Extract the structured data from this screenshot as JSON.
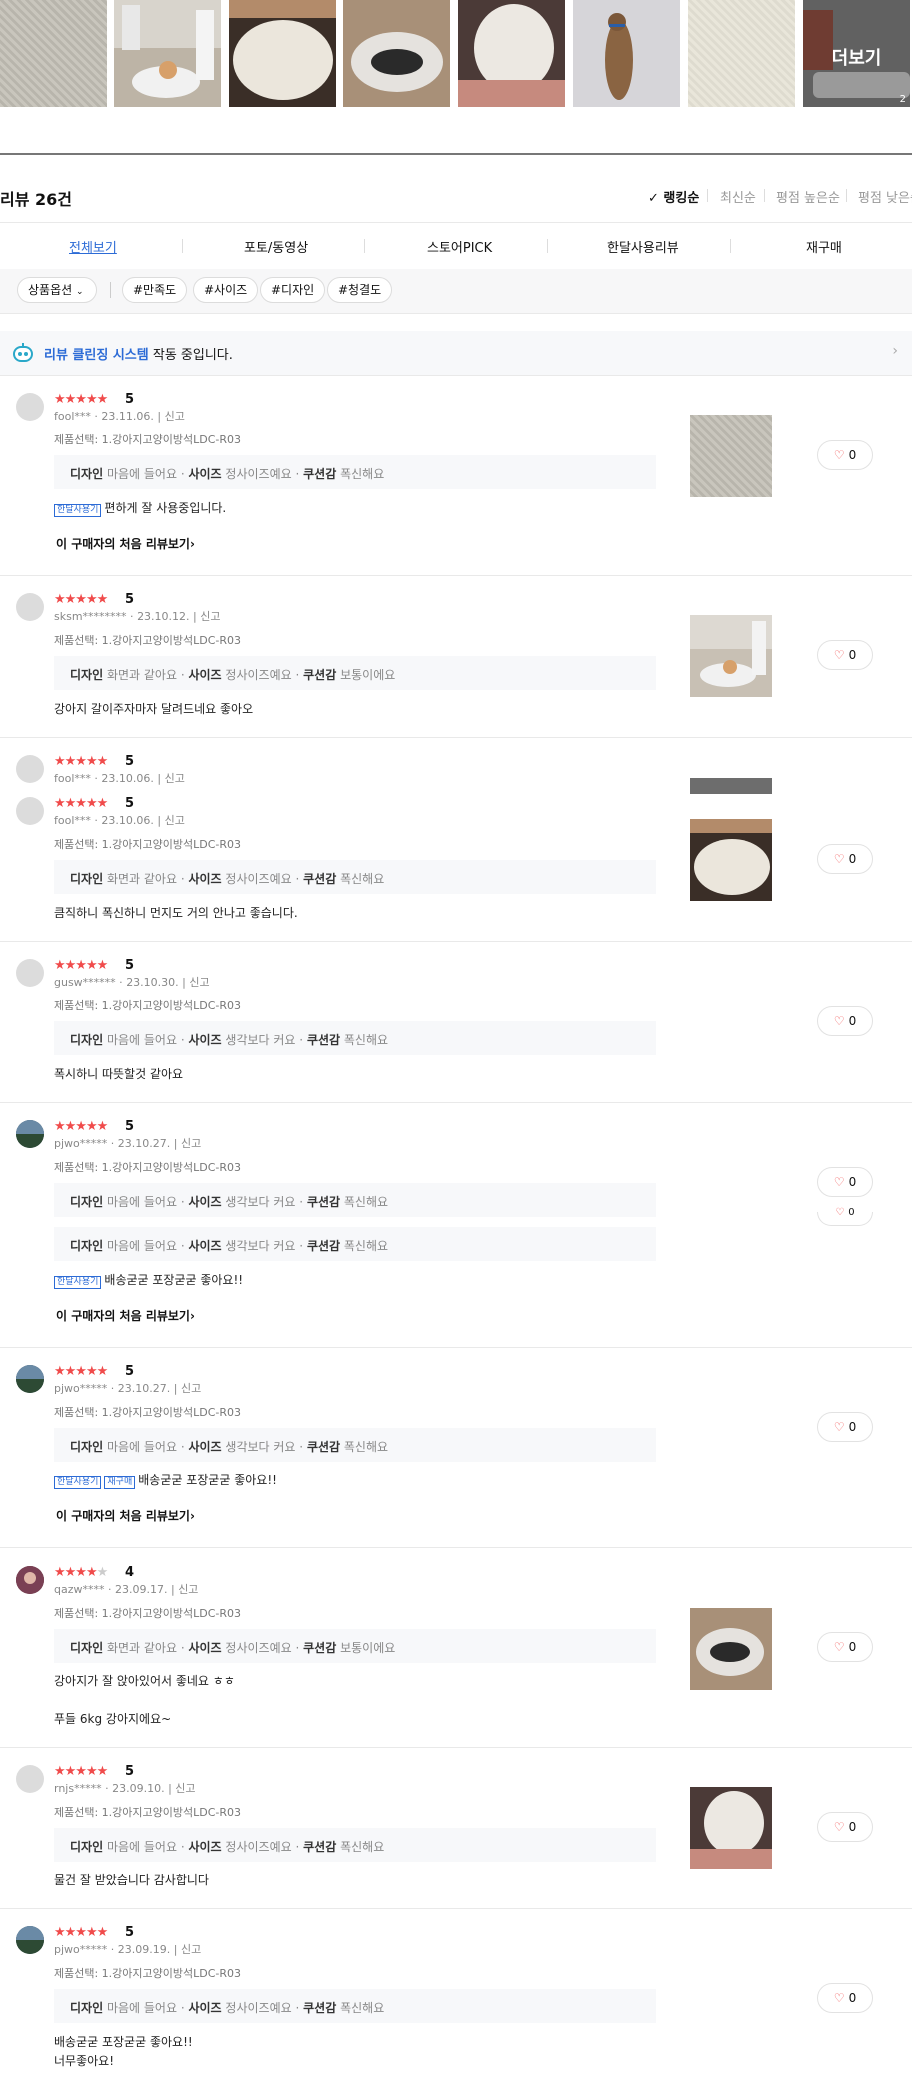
{
  "gallery": {
    "more_label": "더보기",
    "more_count": "2"
  },
  "header": {
    "title": "리뷰 26건",
    "sort": [
      "✓ 랭킹순",
      "최신순",
      "평점 높은순",
      "평점 낮은순"
    ]
  },
  "tabs": [
    "전체보기",
    "포토/동영상",
    "스토어PICK",
    "한달사용리뷰",
    "재구매"
  ],
  "filters": {
    "option": "상품옵션",
    "tags": [
      "#만족도",
      "#사이즈",
      "#디자인",
      "#청결도"
    ]
  },
  "notice": {
    "highlight": "리뷰 클린징 시스템",
    "text": "작동 중입니다."
  },
  "labels": {
    "report": "신고",
    "first_review": "이 구매자의 처음 리뷰보기",
    "badge_month": "한달사용기",
    "badge_rebuy": "재구매"
  },
  "reviews": [
    {
      "stars": 5,
      "score": "5",
      "user": "fool***",
      "date": "23.11.06.",
      "option": "제품선택: 1.강아지고양이방석LDC-R03",
      "attr": [
        [
          "디자인",
          "마음에 들어요"
        ],
        [
          "사이즈",
          "정사이즈예요"
        ],
        [
          "쿠션감",
          "폭신해요"
        ]
      ],
      "text": "편하게 잘 사용중입니다.",
      "likes": "0"
    },
    {
      "stars": 5,
      "score": "5",
      "user": "sksm********",
      "date": "23.10.12.",
      "option": "제품선택: 1.강아지고양이방석LDC-R03",
      "attr": [
        [
          "디자인",
          "화면과 같아요"
        ],
        [
          "사이즈",
          "정사이즈예요"
        ],
        [
          "쿠션감",
          "보통이에요"
        ]
      ],
      "text": "강아지 갈이주자마자 달려드네요 좋아오",
      "likes": "0"
    },
    {
      "stars": 5,
      "score": "5",
      "user": "fool***",
      "date": "23.10.06.",
      "option": "제품선택: 1.강아지고양이방석LDC-R03",
      "attr": [
        [
          "디자인",
          "화면과 같아요"
        ],
        [
          "사이즈",
          "정사이즈예요"
        ],
        [
          "쿠션감",
          "폭신해요"
        ]
      ],
      "text": "큼직하니 폭신하니 먼지도 거의 안나고 좋습니다.",
      "likes": "0"
    },
    {
      "stars": 5,
      "score": "5",
      "user": "gusw******",
      "date": "23.10.30.",
      "option": "제품선택: 1.강아지고양이방석LDC-R03",
      "attr": [
        [
          "디자인",
          "마음에 들어요"
        ],
        [
          "사이즈",
          "생각보다 커요"
        ],
        [
          "쿠션감",
          "폭신해요"
        ]
      ],
      "text": "폭시하니 따뜻할것 같아요",
      "likes": "0"
    },
    {
      "stars": 5,
      "score": "5",
      "user": "pjwo*****",
      "date": "23.10.27.",
      "option": "제품선택: 1.강아지고양이방석LDC-R03",
      "attr": [
        [
          "디자인",
          "마음에 들어요"
        ],
        [
          "사이즈",
          "생각보다 커요"
        ],
        [
          "쿠션감",
          "폭신해요"
        ]
      ],
      "text": "배송굳굳 포장굳굳 좋아요!!",
      "likes": "0"
    },
    {
      "stars": 5,
      "score": "5",
      "user": "pjwo*****",
      "date": "23.10.27.",
      "option": "제품선택: 1.강아지고양이방석LDC-R03",
      "attr": [
        [
          "디자인",
          "마음에 들어요"
        ],
        [
          "사이즈",
          "생각보다 커요"
        ],
        [
          "쿠션감",
          "폭신해요"
        ]
      ],
      "text": "배송굳굳 포장굳굳 좋아요!!",
      "likes": "0"
    },
    {
      "stars": 4,
      "score": "4",
      "user": "qazw****",
      "date": "23.09.17.",
      "option": "제품선택: 1.강아지고양이방석LDC-R03",
      "attr": [
        [
          "디자인",
          "화면과 같아요"
        ],
        [
          "사이즈",
          "정사이즈예요"
        ],
        [
          "쿠션감",
          "보통이에요"
        ]
      ],
      "text": "강아지가 잘 앉아있어서 좋네요 ㅎㅎ",
      "text2": "푸들 6kg 강아지에요~",
      "likes": "0"
    },
    {
      "stars": 5,
      "score": "5",
      "user": "rnjs*****",
      "date": "23.09.10.",
      "option": "제품선택: 1.강아지고양이방석LDC-R03",
      "attr": [
        [
          "디자인",
          "마음에 들어요"
        ],
        [
          "사이즈",
          "정사이즈예요"
        ],
        [
          "쿠션감",
          "폭신해요"
        ]
      ],
      "text": "물건 잘 받았습니다 감사합니다",
      "likes": "0"
    },
    {
      "stars": 5,
      "score": "5",
      "user": "pjwo*****",
      "date": "23.09.19.",
      "option": "제품선택: 1.강아지고양이방석LDC-R03",
      "attr": [
        [
          "디자인",
          "마음에 들어요"
        ],
        [
          "사이즈",
          "정사이즈예요"
        ],
        [
          "쿠션감",
          "폭신해요"
        ]
      ],
      "text": "배송굳굳 포장굳굳 좋아요!!",
      "text2": "너무좋아요!",
      "likes": "0"
    }
  ]
}
